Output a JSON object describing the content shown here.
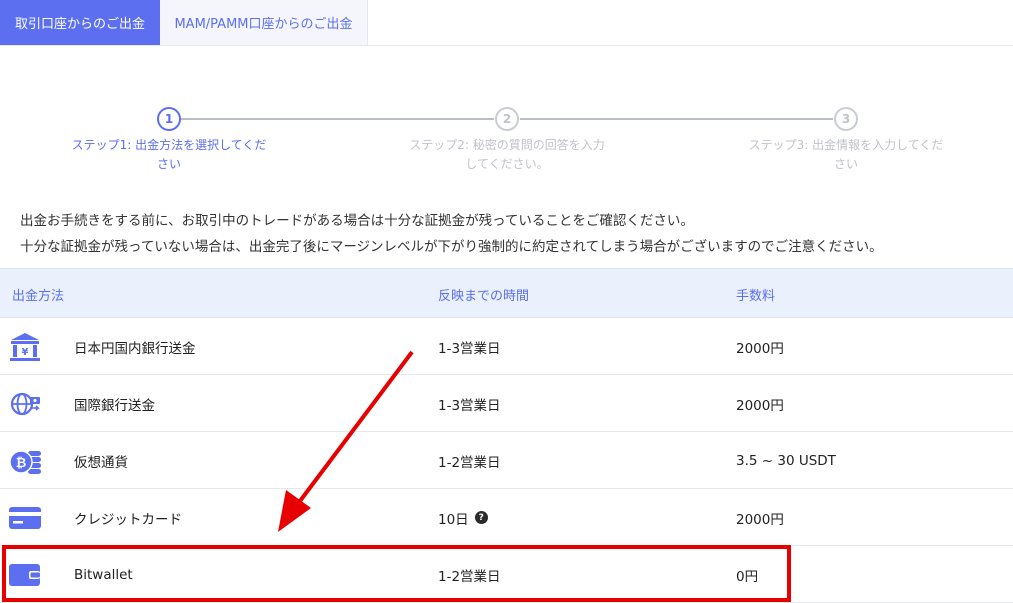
{
  "tabs": [
    {
      "label": "取引口座からのご出金",
      "active": true
    },
    {
      "label": "MAM/PAMM口座からのご出金",
      "active": false
    }
  ],
  "steps": [
    {
      "number": "1",
      "line1": "ステップ1: 出金方法を選択してくだ",
      "line2": "さい",
      "active": true
    },
    {
      "number": "2",
      "line1": "ステップ2: 秘密の質問の回答を入力",
      "line2": "してください。",
      "active": false
    },
    {
      "number": "3",
      "line1": "ステップ3: 出金情報を入力してくだ",
      "line2": "さい",
      "active": false
    }
  ],
  "notice": {
    "line1": "出金お手続きをする前に、お取引中のトレードがある場合は十分な証拠金が残っていることをご確認ください。",
    "line2": "十分な証拠金が残っていない場合は、出金完了後にマージンレベルが下がり強制的に約定されてしまう場合がございますのでご注意ください。"
  },
  "table": {
    "headers": {
      "method": "出金方法",
      "time": "反映までの時間",
      "fee": "手数料"
    },
    "rows": [
      {
        "icon": "bank-yen-icon",
        "method": "日本円国内銀行送金",
        "time": "1-3営業日",
        "fee": "2000円"
      },
      {
        "icon": "globe-transfer-icon",
        "method": "国際銀行送金",
        "time": "1-3営業日",
        "fee": "2000円"
      },
      {
        "icon": "bitcoin-coins-icon",
        "method": "仮想通貨",
        "time": "1-2営業日",
        "fee": "3.5 ~ 30 USDT"
      },
      {
        "icon": "credit-card-icon",
        "method": "クレジットカード",
        "time": "10日",
        "time_help": "?",
        "fee": "2000円"
      },
      {
        "icon": "wallet-icon",
        "method": "Bitwallet",
        "time": "1-2営業日",
        "fee": "0円"
      }
    ]
  },
  "colors": {
    "accent": "#5b6ff0",
    "annotation": "#e60000",
    "header_bg": "#eaf0fc"
  }
}
